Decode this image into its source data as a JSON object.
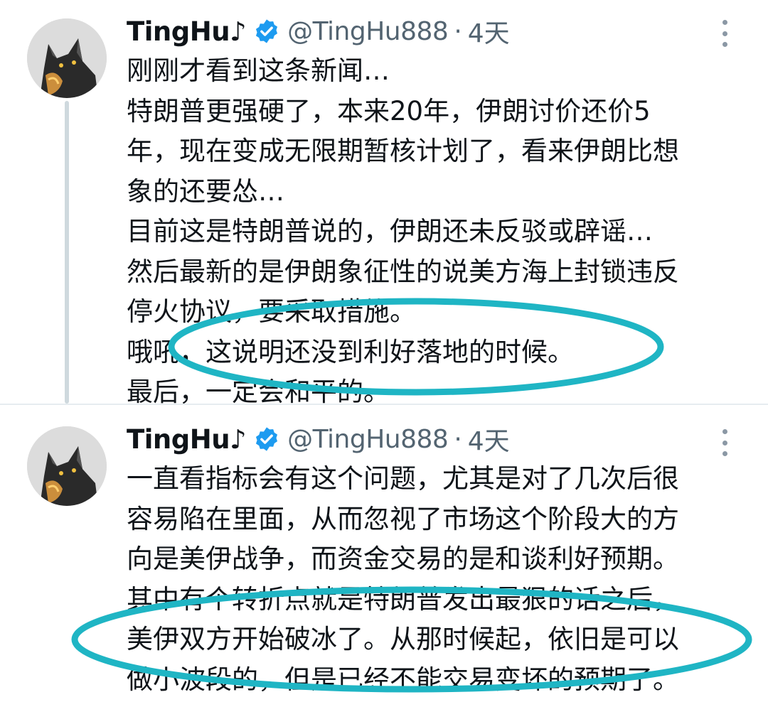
{
  "tweets": [
    {
      "display_name": "TingHu♪",
      "handle": "@TingHu888",
      "separator": "·",
      "time": "4天",
      "lines": [
        "刚刚才看到这条新闻…",
        "特朗普更强硬了，本来20年，伊朗讨价还价5",
        "年，现在变成无限期暂核计划了，看来伊朗比想",
        "象的还要怂…",
        "目前这是特朗普说的，伊朗还未反驳或辟谣…",
        "然后最新的是伊朗象征性的说美方海上封锁违反",
        "停火协议，要采取措施。",
        "哦吼，这说明还没到利好落地的时候。",
        "最后，一定会和平的。"
      ]
    },
    {
      "display_name": "TingHu♪",
      "handle": "@TingHu888",
      "separator": "·",
      "time": "4天",
      "lines": [
        "一直看指标会有这个问题，尤其是对了几次后很",
        "容易陷在里面，从而忽视了市场这个阶段大的方",
        "向是美伊战争，而资金交易的是和谈利好预期。",
        "其中有个转折点就是特朗普发出最狠的话之后，",
        "美伊双方开始破冰了。从那时候起，依旧是可以",
        "做小波段的，但是已经不能交易变坏的预期了。"
      ]
    }
  ],
  "colors": {
    "verified_badge": "#1d9bf0",
    "highlight_ellipse": "#1fb5c4",
    "secondary_text": "#536471",
    "thread_line": "#cfd9de"
  },
  "icons": {
    "verified": "verified-badge-icon",
    "more": "more-options-icon"
  }
}
